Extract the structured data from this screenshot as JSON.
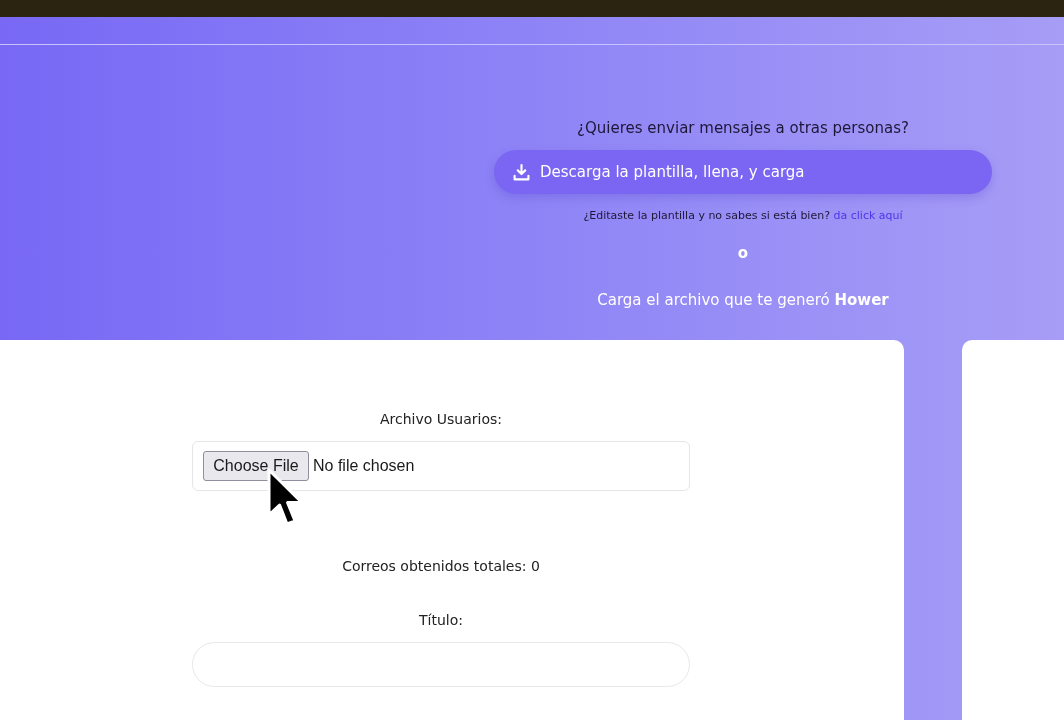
{
  "header": {
    "question": "¿Quieres enviar mensajes a otras personas?",
    "download_button": {
      "label": "Descarga la plantilla, llena, y carga"
    },
    "help_text": "¿Editaste la plantilla y no sabes si está bien?",
    "help_link": "da click aquí",
    "separator": "o",
    "upload_prompt": "Carga el archivo que te generó **Hower**"
  },
  "form": {
    "file_label": "Archivo Usuarios:",
    "file_input": {
      "button": "Choose File",
      "status": "No file chosen"
    },
    "email_count": "Correos obtenidos totales: 0",
    "title_label": "Título:"
  }
}
